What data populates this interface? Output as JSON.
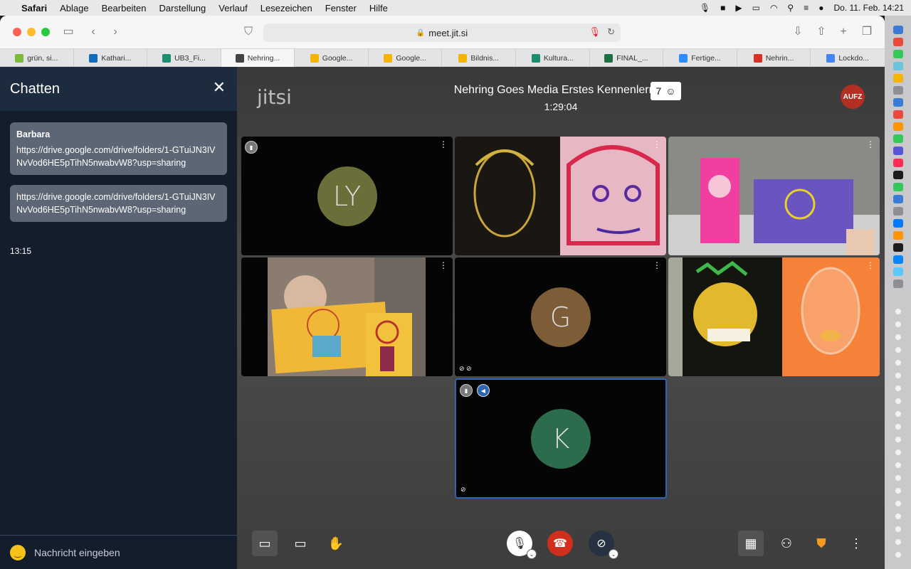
{
  "menubar": {
    "app": "Safari",
    "items": [
      "Ablage",
      "Bearbeiten",
      "Darstellung",
      "Verlauf",
      "Lesezeichen",
      "Fenster",
      "Hilfe"
    ],
    "clock": "Do. 11. Feb. 14:21"
  },
  "browser": {
    "url": "meet.jit.si",
    "tabs": [
      {
        "label": "grün, si...",
        "color": "#7cba3a"
      },
      {
        "label": "Kathari...",
        "color": "#0f6cbd"
      },
      {
        "label": "UB3_Fi...",
        "color": "#1a8f6f"
      },
      {
        "label": "Nehring...",
        "color": "#444444"
      },
      {
        "label": "Google...",
        "color": "#f4b400"
      },
      {
        "label": "Google...",
        "color": "#f4b400"
      },
      {
        "label": "Bildnis...",
        "color": "#f4b400"
      },
      {
        "label": "Kultura...",
        "color": "#1a8f6f"
      },
      {
        "label": "FINAL_...",
        "color": "#1d7044"
      },
      {
        "label": "Fertige...",
        "color": "#2d8cff"
      },
      {
        "label": "Nehrin...",
        "color": "#d93025"
      },
      {
        "label": "Lockdo...",
        "color": "#4285f4"
      }
    ]
  },
  "chat": {
    "title": "Chatten",
    "messages": [
      {
        "from": "Barbara",
        "text": "https://drive.google.com/drive/folders/1-GTuiJN3IVNvVod6HE5pTihN5nwabvW8?usp=sharing"
      },
      {
        "from": "",
        "text": "https://drive.google.com/drive/folders/1-GTuiJN3IVNvVod6HE5pTihN5nwabvW8?usp=sharing"
      }
    ],
    "time": "13:15",
    "input_placeholder": "Nachricht eingeben"
  },
  "conference": {
    "logo": "jitsi",
    "title": "Nehring Goes Media Erstes Kennenlernen",
    "duration": "1:29:04",
    "participant_count": "7",
    "recording_badge": "AUFZ"
  },
  "tiles": [
    {
      "type": "avatar",
      "initials": "LY",
      "color": "#6a6e38",
      "signal": true
    },
    {
      "type": "video",
      "scene": "portraits-pink"
    },
    {
      "type": "video",
      "scene": "portraits-purple"
    },
    {
      "type": "video",
      "scene": "portraits-yellow"
    },
    {
      "type": "avatar",
      "initials": "G",
      "color": "#7d5d37",
      "muted": true
    },
    {
      "type": "video",
      "scene": "portraits-orange"
    },
    {
      "type": "avatar",
      "initials": "K",
      "color": "#2d6b4d",
      "signal": true,
      "speaker": true,
      "muted": true,
      "dominant": true
    }
  ],
  "toolbar_icons": {
    "chat": "chat-icon",
    "screenshare": "screen-share-icon",
    "raise_hand": "raise-hand-icon",
    "mic": "microphone-icon",
    "hangup": "hangup-icon",
    "camera": "camera-off-icon",
    "tile_view": "tile-view-icon",
    "invite": "invite-icon",
    "security": "security-shield-icon",
    "more": "more-icon"
  },
  "colors": {
    "hangup": "#d12f1e",
    "sidebar": "#141d2b",
    "dominant_border": "#2f64b3"
  }
}
